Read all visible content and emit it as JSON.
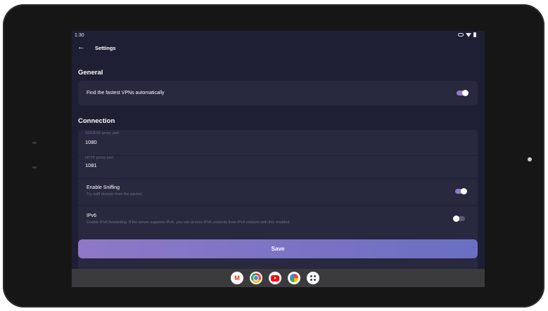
{
  "status_bar": {
    "time": "1:30"
  },
  "app_bar": {
    "back_icon": "arrow-left-icon",
    "title": "Settings"
  },
  "general": {
    "title": "General",
    "auto_fastest": {
      "label": "Find the fastest VPNs automatically",
      "enabled": true
    }
  },
  "connection": {
    "title": "Connection",
    "socks_port": {
      "label": "SOCKS5 proxy port",
      "value": "1080"
    },
    "http_port": {
      "label": "HTTP proxy port",
      "value": "1081"
    },
    "sniffing": {
      "label": "Enable Sniffing",
      "description": "Try sniff domain from the packet.",
      "enabled": true
    },
    "ipv6": {
      "label": "IPv6",
      "description": "Enable IPv6 forwarding. If the server supports IPv6, you can access IPv6 contents from IPv4 network with this enabled.",
      "enabled": false
    }
  },
  "save_button": {
    "label": "Save"
  },
  "taskbar": {
    "apps": [
      "gmail-icon",
      "chrome-icon",
      "youtube-icon",
      "photos-icon",
      "app-drawer-icon"
    ]
  },
  "colors": {
    "background": "#1e1e34",
    "card": "#28283f",
    "accent_start": "#8f78c7",
    "accent_end": "#6a6fc2",
    "toggle_on": "#8f7cc4"
  }
}
